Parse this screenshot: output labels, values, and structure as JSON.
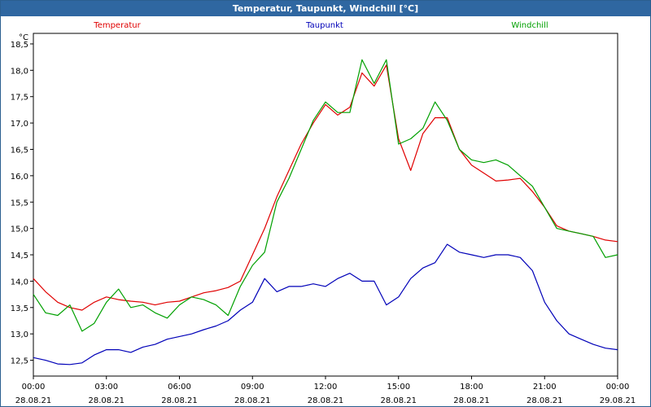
{
  "title": "Temperatur, Taupunkt, Windchill [°C]",
  "chart_data": {
    "type": "line",
    "ylabel": "°C",
    "ylim": [
      12.2,
      18.7
    ],
    "y_ticks": [
      "12,5",
      "13,0",
      "13,5",
      "14,0",
      "14,5",
      "15,0",
      "15,5",
      "16,0",
      "16,5",
      "17,0",
      "17,5",
      "18,0",
      "18,5"
    ],
    "x_labels": [
      {
        "time": "00:00",
        "date": "28.08.21"
      },
      {
        "time": "03:00",
        "date": "28.08.21"
      },
      {
        "time": "06:00",
        "date": "28.08.21"
      },
      {
        "time": "09:00",
        "date": "28.08.21"
      },
      {
        "time": "12:00",
        "date": "28.08.21"
      },
      {
        "time": "15:00",
        "date": "28.08.21"
      },
      {
        "time": "18:00",
        "date": "28.08.21"
      },
      {
        "time": "21:00",
        "date": "28.08.21"
      },
      {
        "time": "00:00",
        "date": "29.08.21"
      }
    ],
    "x_range_hours": [
      0,
      24
    ],
    "grid": true,
    "series": [
      {
        "name": "Temperatur",
        "color": "#e00000",
        "points": [
          [
            0.0,
            14.05
          ],
          [
            0.5,
            13.8
          ],
          [
            1.0,
            13.6
          ],
          [
            1.5,
            13.5
          ],
          [
            2.0,
            13.45
          ],
          [
            2.5,
            13.6
          ],
          [
            3.0,
            13.7
          ],
          [
            3.5,
            13.65
          ],
          [
            4.0,
            13.62
          ],
          [
            4.5,
            13.6
          ],
          [
            5.0,
            13.55
          ],
          [
            5.5,
            13.6
          ],
          [
            6.0,
            13.62
          ],
          [
            6.5,
            13.7
          ],
          [
            7.0,
            13.78
          ],
          [
            7.5,
            13.82
          ],
          [
            8.0,
            13.88
          ],
          [
            8.5,
            14.0
          ],
          [
            9.0,
            14.5
          ],
          [
            9.5,
            15.0
          ],
          [
            10.0,
            15.6
          ],
          [
            10.5,
            16.1
          ],
          [
            11.0,
            16.6
          ],
          [
            11.5,
            17.0
          ],
          [
            12.0,
            17.35
          ],
          [
            12.5,
            17.15
          ],
          [
            13.0,
            17.3
          ],
          [
            13.5,
            17.95
          ],
          [
            14.0,
            17.7
          ],
          [
            14.5,
            18.1
          ],
          [
            15.0,
            16.7
          ],
          [
            15.5,
            16.1
          ],
          [
            16.0,
            16.8
          ],
          [
            16.5,
            17.1
          ],
          [
            17.0,
            17.1
          ],
          [
            17.5,
            16.5
          ],
          [
            18.0,
            16.2
          ],
          [
            18.5,
            16.05
          ],
          [
            19.0,
            15.9
          ],
          [
            19.5,
            15.92
          ],
          [
            20.0,
            15.95
          ],
          [
            20.5,
            15.7
          ],
          [
            21.0,
            15.4
          ],
          [
            21.5,
            15.05
          ],
          [
            22.0,
            14.95
          ],
          [
            22.5,
            14.9
          ],
          [
            23.0,
            14.85
          ],
          [
            23.5,
            14.78
          ],
          [
            24.0,
            14.75
          ]
        ]
      },
      {
        "name": "Taupunkt",
        "color": "#0000b8",
        "points": [
          [
            0.0,
            12.55
          ],
          [
            0.5,
            12.5
          ],
          [
            1.0,
            12.43
          ],
          [
            1.5,
            12.42
          ],
          [
            2.0,
            12.45
          ],
          [
            2.5,
            12.6
          ],
          [
            3.0,
            12.7
          ],
          [
            3.5,
            12.7
          ],
          [
            4.0,
            12.65
          ],
          [
            4.5,
            12.75
          ],
          [
            5.0,
            12.8
          ],
          [
            5.5,
            12.9
          ],
          [
            6.0,
            12.95
          ],
          [
            6.5,
            13.0
          ],
          [
            7.0,
            13.08
          ],
          [
            7.5,
            13.15
          ],
          [
            8.0,
            13.25
          ],
          [
            8.5,
            13.45
          ],
          [
            9.0,
            13.6
          ],
          [
            9.5,
            14.05
          ],
          [
            10.0,
            13.8
          ],
          [
            10.5,
            13.9
          ],
          [
            11.0,
            13.9
          ],
          [
            11.5,
            13.95
          ],
          [
            12.0,
            13.9
          ],
          [
            12.5,
            14.05
          ],
          [
            13.0,
            14.15
          ],
          [
            13.5,
            14.0
          ],
          [
            14.0,
            14.0
          ],
          [
            14.5,
            13.55
          ],
          [
            15.0,
            13.7
          ],
          [
            15.5,
            14.05
          ],
          [
            16.0,
            14.25
          ],
          [
            16.5,
            14.35
          ],
          [
            17.0,
            14.7
          ],
          [
            17.5,
            14.55
          ],
          [
            18.0,
            14.5
          ],
          [
            18.5,
            14.45
          ],
          [
            19.0,
            14.5
          ],
          [
            19.5,
            14.5
          ],
          [
            20.0,
            14.45
          ],
          [
            20.5,
            14.2
          ],
          [
            21.0,
            13.6
          ],
          [
            21.5,
            13.25
          ],
          [
            22.0,
            13.0
          ],
          [
            22.5,
            12.9
          ],
          [
            23.0,
            12.8
          ],
          [
            23.5,
            12.73
          ],
          [
            24.0,
            12.7
          ]
        ]
      },
      {
        "name": "Windchill",
        "color": "#00a000",
        "points": [
          [
            0.0,
            13.75
          ],
          [
            0.5,
            13.4
          ],
          [
            1.0,
            13.35
          ],
          [
            1.5,
            13.55
          ],
          [
            2.0,
            13.05
          ],
          [
            2.5,
            13.2
          ],
          [
            3.0,
            13.6
          ],
          [
            3.5,
            13.85
          ],
          [
            4.0,
            13.5
          ],
          [
            4.5,
            13.55
          ],
          [
            5.0,
            13.4
          ],
          [
            5.5,
            13.3
          ],
          [
            6.0,
            13.55
          ],
          [
            6.5,
            13.7
          ],
          [
            7.0,
            13.65
          ],
          [
            7.5,
            13.55
          ],
          [
            8.0,
            13.35
          ],
          [
            8.5,
            13.9
          ],
          [
            9.0,
            14.3
          ],
          [
            9.5,
            14.55
          ],
          [
            10.0,
            15.5
          ],
          [
            10.5,
            15.95
          ],
          [
            11.0,
            16.5
          ],
          [
            11.5,
            17.05
          ],
          [
            12.0,
            17.4
          ],
          [
            12.5,
            17.2
          ],
          [
            13.0,
            17.2
          ],
          [
            13.5,
            18.2
          ],
          [
            14.0,
            17.75
          ],
          [
            14.5,
            18.2
          ],
          [
            15.0,
            16.6
          ],
          [
            15.5,
            16.7
          ],
          [
            16.0,
            16.9
          ],
          [
            16.5,
            17.4
          ],
          [
            17.0,
            17.05
          ],
          [
            17.5,
            16.5
          ],
          [
            18.0,
            16.3
          ],
          [
            18.5,
            16.25
          ],
          [
            19.0,
            16.3
          ],
          [
            19.5,
            16.2
          ],
          [
            20.0,
            16.0
          ],
          [
            20.5,
            15.8
          ],
          [
            21.0,
            15.4
          ],
          [
            21.5,
            15.0
          ],
          [
            22.0,
            14.95
          ],
          [
            22.5,
            14.9
          ],
          [
            23.0,
            14.85
          ],
          [
            23.5,
            14.45
          ],
          [
            24.0,
            14.5
          ]
        ]
      }
    ]
  }
}
